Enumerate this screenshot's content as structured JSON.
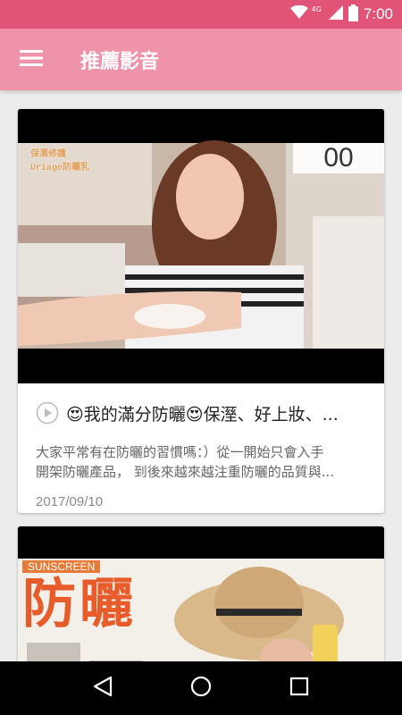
{
  "status_bar": {
    "time": "7:00",
    "network": "4G",
    "icons": [
      "wifi-icon",
      "signal-icon",
      "battery-icon"
    ]
  },
  "app_bar": {
    "title": "推薦影音",
    "menu_icon": "hamburger-menu-icon"
  },
  "videos": [
    {
      "title": "😍我的滿分防曬😍保溼、好上妝、...",
      "description_line1": "大家平常有在防曬的習慣嗎：）從一開始只會入手",
      "description_line2": "開架防曬產品， 到後來越來越注重防曬的品質與...",
      "date": "2017/09/10",
      "thumb_overlay_text": "00",
      "thumb_caption_line1": "保濕修護",
      "thumb_caption_line2": "Uriage防曬乳"
    },
    {
      "thumb_label": "SUNSCREEN",
      "thumb_title": "防曬"
    }
  ],
  "nav_bar": {
    "buttons": [
      "back-icon",
      "home-icon",
      "recents-icon"
    ]
  },
  "colors": {
    "status_bar": "#e15377",
    "app_bar": "#ef93ab",
    "background": "#ececec"
  }
}
